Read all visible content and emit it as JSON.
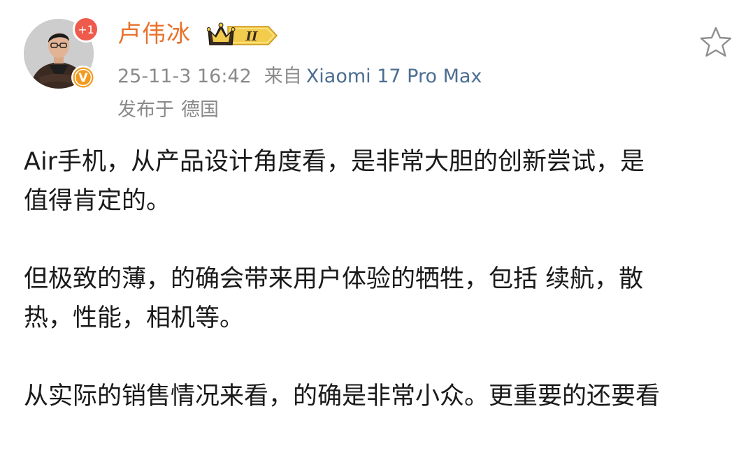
{
  "post": {
    "author": {
      "name": "卢伟冰",
      "avatar_badge": "+1",
      "vip_level": "II",
      "verified_mark": "V"
    },
    "time": "25-11-3 16:42",
    "source_prefix": "来自",
    "device": "Xiaomi 17 Pro Max",
    "location_prefix": "发布于",
    "location": "德国",
    "paragraphs": [
      {
        "line1": "Air手机，从产品设计角度看，是非常大胆的创新尝试，是",
        "line2": "值得肯定的。"
      },
      {
        "line1": "但极致的薄，的确会带来用户体验的牺牲，包括 续航，散",
        "line2": "热，性能，相机等。"
      },
      {
        "line1": "从实际的销售情况来看，的确是非常小众。更重要的还要看"
      }
    ]
  },
  "icons": {
    "favorite": "star-outline-icon",
    "verified": "verified-v-icon",
    "vip": "crown-vip-icon"
  },
  "colors": {
    "username": "#e8722d",
    "device_link": "#4b6e91",
    "meta_gray": "#8a8a8a",
    "badge_red": "#ee5a4c",
    "verified_orange": "#f29a1f"
  }
}
